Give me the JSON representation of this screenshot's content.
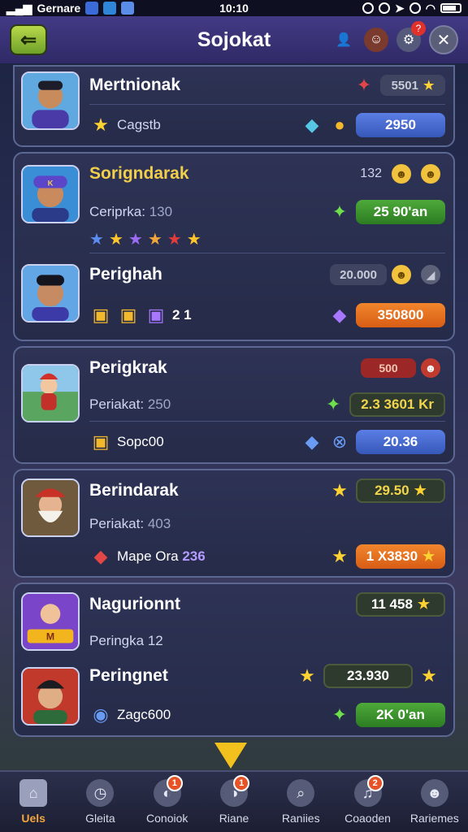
{
  "status_bar": {
    "carrier": "Gernare",
    "time": "10:10"
  },
  "header": {
    "title": "Sojokat"
  },
  "players": [
    {
      "name": "Mertnionak",
      "sub_label": "Cagstb",
      "badge": "5501",
      "value": "2950",
      "value_style": "blue"
    },
    {
      "name": "Sorigndarak",
      "sub_label": "Ceriprka:",
      "sub_number": "130",
      "badge": "132",
      "value": "25 90'an",
      "value_style": "green"
    },
    {
      "name": "Perighah",
      "sub_label": "2 1",
      "badge": "20.000",
      "value": "350800",
      "value_style": "orange"
    },
    {
      "name": "Perigkrak",
      "sub_label": "Periakat:",
      "sub_number": "250",
      "badge": "500",
      "value": "2.3 3601 Kr",
      "value_style": "dark",
      "extra_label": "Sopc00",
      "extra_value": "20.36"
    },
    {
      "name": "Berindarak",
      "sub_label": "Periakat:",
      "sub_number": "403",
      "badge": "29.50",
      "extra_label": "Mape Ora",
      "extra_number": "236",
      "value": "1 X3830",
      "value_style": "orange"
    },
    {
      "name": "Nagurionnt",
      "sub_label": "Peringka 12",
      "badge": "11 458",
      "value_style": "green"
    },
    {
      "name": "Peringnet",
      "sub_label": "Zagc600",
      "badge": "23.930",
      "value": "2K 0'an",
      "value_style": "green"
    }
  ],
  "nav": [
    {
      "label": "Uels",
      "active": true
    },
    {
      "label": "Gleita"
    },
    {
      "label": "Conoiok",
      "badge": "1"
    },
    {
      "label": "Riane",
      "badge": "1"
    },
    {
      "label": "Raniies"
    },
    {
      "label": "Coaoden",
      "badge": "2"
    },
    {
      "label": "Rariemes"
    }
  ],
  "colors": {
    "accent": "#f3a43c",
    "green_button": "#8fc13a"
  }
}
